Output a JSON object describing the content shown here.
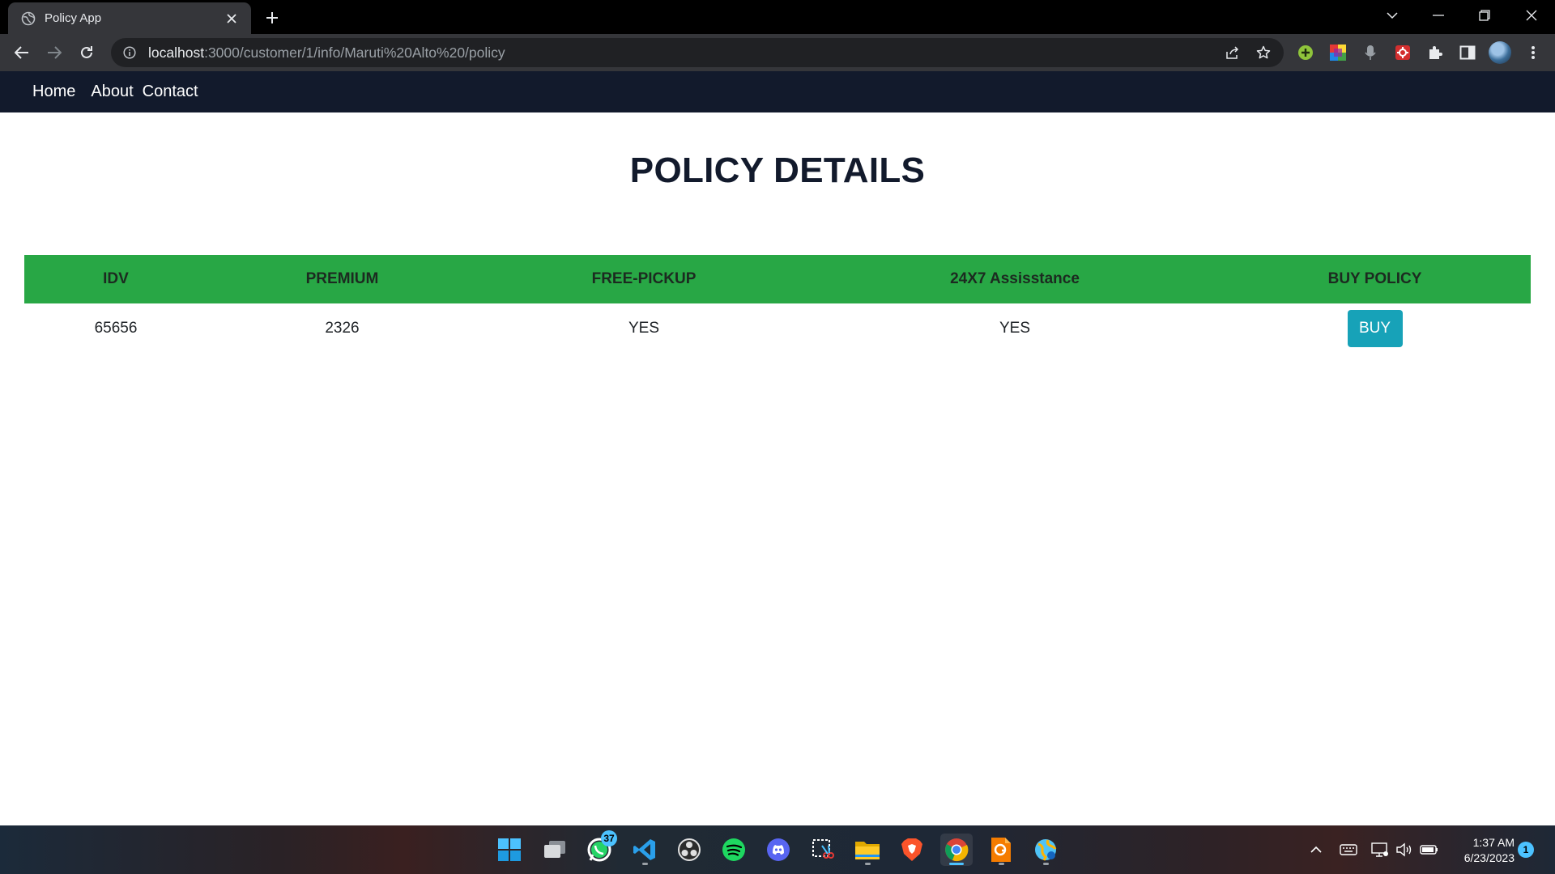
{
  "browser": {
    "tab_title": "Policy App",
    "url_host": "localhost",
    "url_path": ":3000/customer/1/info/Maruti%20Alto%20/policy"
  },
  "navbar": {
    "links": [
      "Home",
      "About",
      "Contact"
    ]
  },
  "page": {
    "title": "POLICY DETAILS"
  },
  "table": {
    "headers": [
      "IDV",
      "PREMIUM",
      "FREE-PICKUP",
      "24X7 Assisstance",
      "BUY POLICY"
    ],
    "rows": [
      {
        "idv": "65656",
        "premium": "2326",
        "free_pickup": "YES",
        "assistance": "YES",
        "buy_label": "BUY"
      }
    ]
  },
  "taskbar": {
    "whatsapp_badge": "37",
    "time": "1:37 AM",
    "date": "6/23/2023",
    "notification_count": "1"
  },
  "colors": {
    "navbar_bg": "#121a2c",
    "table_header_bg": "#28a745",
    "buy_button_bg": "#17a2b8"
  }
}
